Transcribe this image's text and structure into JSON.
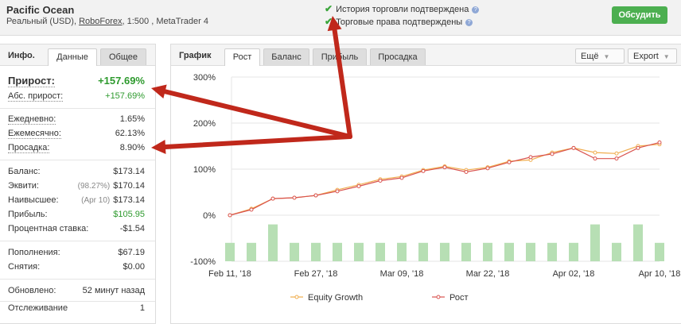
{
  "account": {
    "name": "Pacific Ocean",
    "type": "Реальный (USD),",
    "broker": "RoboForex",
    "leverage_platform": ", 1:500 , MetaTrader 4"
  },
  "verification": {
    "history": "История торговли подтверждена",
    "rights": "Торговые права подтверждены",
    "help_glyph": "?"
  },
  "discuss_button": "Обсудить",
  "info_panel": {
    "title": "Инфо.",
    "tabs": [
      "Данные",
      "Общее"
    ],
    "growth": {
      "label": "Прирост:",
      "value": "+157.69%"
    },
    "abs_growth": {
      "label": "Абс. прирост:",
      "value": "+157.69%"
    },
    "daily": {
      "label": "Ежедневно:",
      "value": "1.65%"
    },
    "monthly": {
      "label": "Ежемесячно:",
      "value": "62.13%"
    },
    "drawdown": {
      "label": "Просадка:",
      "value": "8.90%"
    },
    "balance": {
      "label": "Баланс:",
      "value": "$173.14"
    },
    "equity": {
      "label": "Эквити:",
      "note": "(98.27%)",
      "value": "$170.14"
    },
    "highest": {
      "label": "Наивысшее:",
      "note": "(Apr 10)",
      "value": "$173.14"
    },
    "profit": {
      "label": "Прибыль:",
      "value": "$105.95"
    },
    "interest": {
      "label": "Процентная ставка:",
      "value": "-$1.54"
    },
    "deposits": {
      "label": "Пополнения:",
      "value": "$67.19"
    },
    "withdrawals": {
      "label": "Снятия:",
      "value": "$0.00"
    },
    "updated": {
      "label": "Обновлено:",
      "value": "52 минут назад"
    },
    "tracking": {
      "label": "Отслеживание",
      "value": "1"
    }
  },
  "chart_panel": {
    "title": "График",
    "tabs": [
      "Рост",
      "Баланс",
      "Прибыль",
      "Просадка"
    ],
    "more_button": "Ещё",
    "export_button": "Export",
    "caret": "▼"
  },
  "colors": {
    "growth_line": "#d9534f",
    "equity_line": "#f0ad4e",
    "bars": "#b7dfb4",
    "arrow": "#c0281b",
    "accent_green": "#4caf50"
  },
  "chart_data": {
    "type": "line",
    "title": "",
    "ylim": [
      -100,
      300
    ],
    "yticks": [
      "300%",
      "200%",
      "100%",
      "0%",
      "-100%"
    ],
    "ytick_values": [
      300,
      200,
      100,
      0,
      -100
    ],
    "xticks": [
      "Feb 11, '18",
      "Feb 27, '18",
      "Mar 09, '18",
      "Mar 22, '18",
      "Apr 02, '18",
      "Apr 10, '18"
    ],
    "xtick_positions": [
      0,
      4,
      8,
      12,
      16,
      20
    ],
    "x_count": 21,
    "series": [
      {
        "name": "Equity Growth",
        "values": [
          0,
          14,
          36,
          38,
          43,
          55,
          66,
          78,
          84,
          98,
          106,
          98,
          104,
          117,
          120,
          136,
          146,
          136,
          134,
          150,
          154
        ]
      },
      {
        "name": "Рост",
        "values": [
          0,
          12,
          36,
          38,
          43,
          52,
          63,
          75,
          81,
          96,
          104,
          94,
          102,
          115,
          126,
          133,
          146,
          123,
          123,
          146,
          158
        ]
      }
    ],
    "bars": [
      -60,
      -60,
      -20,
      -60,
      -60,
      -60,
      -60,
      -60,
      -60,
      -60,
      -60,
      -60,
      -60,
      -60,
      -60,
      -60,
      -60,
      -20,
      -60,
      -20,
      -60
    ],
    "legend": [
      "Equity Growth",
      "Рост"
    ],
    "grid": true
  }
}
